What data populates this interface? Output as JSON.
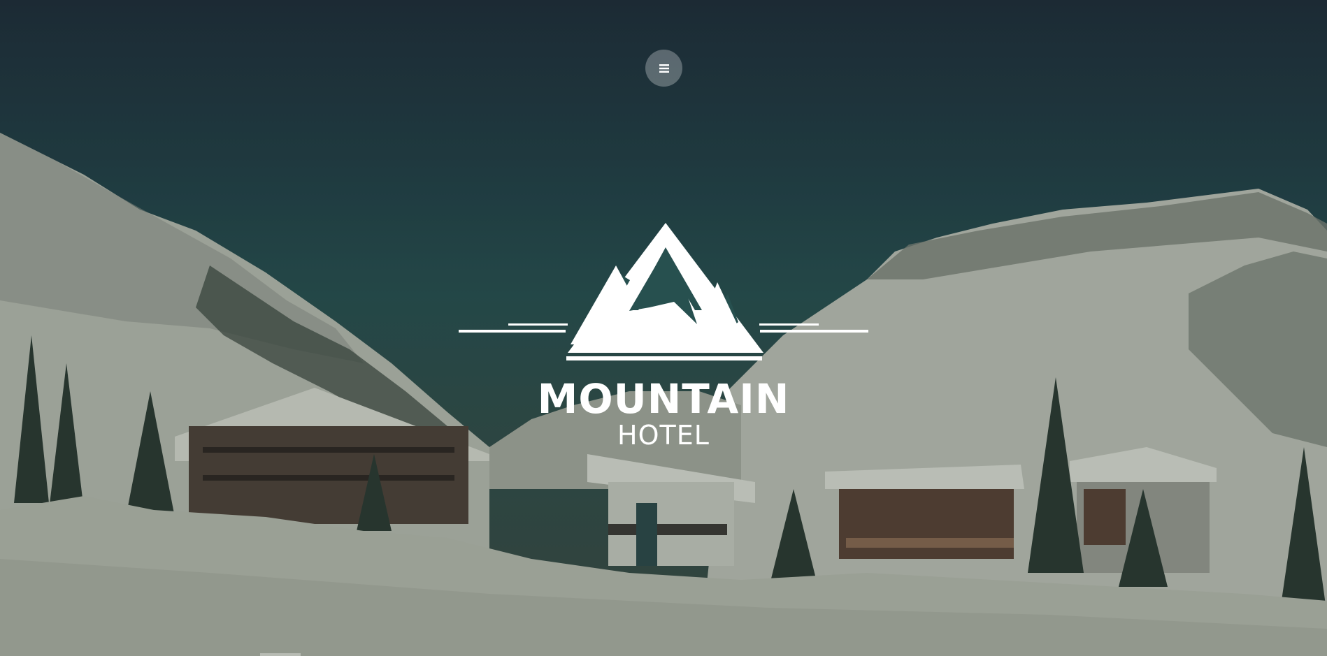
{
  "brand": {
    "title": "MOUNTAIN",
    "subtitle": "HOTEL",
    "logo_icon": "mountain-icon"
  },
  "nav": {
    "menu_icon": "hamburger-menu-icon"
  },
  "colors": {
    "sky_top": "#1e2d38",
    "sky_mid": "#27504f",
    "snow": "#c9cdbf",
    "logo": "#ffffff"
  }
}
